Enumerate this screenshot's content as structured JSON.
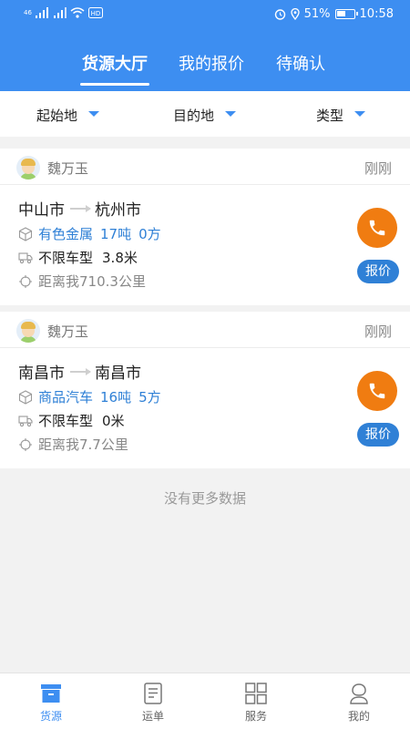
{
  "status_bar": {
    "signal_text": "46",
    "battery": "51%",
    "time": "10:58",
    "hd_label": "HD"
  },
  "tabs": [
    {
      "label": "货源大厅",
      "active": true
    },
    {
      "label": "我的报价",
      "active": false
    },
    {
      "label": "待确认",
      "active": false
    }
  ],
  "filters": {
    "origin": "起始地",
    "destination": "目的地",
    "type": "类型"
  },
  "cards": [
    {
      "user": "魏万玉",
      "time": "刚刚",
      "from": "中山市",
      "to": "杭州市",
      "cargo": "有色金属",
      "weight": "17吨",
      "volume": "0方",
      "vehicle": "不限车型",
      "length": "3.8米",
      "distance": "距离我710.3公里",
      "quote_label": "报价"
    },
    {
      "user": "魏万玉",
      "time": "刚刚",
      "from": "南昌市",
      "to": "南昌市",
      "cargo": "商品汽车",
      "weight": "16吨",
      "volume": "5方",
      "vehicle": "不限车型",
      "length": "0米",
      "distance": "距离我7.7公里",
      "quote_label": "报价"
    }
  ],
  "no_more_text": "没有更多数据",
  "bottom_nav": [
    {
      "label": "货源",
      "icon": "box-icon",
      "active": true
    },
    {
      "label": "运单",
      "icon": "document-icon",
      "active": false
    },
    {
      "label": "服务",
      "icon": "grid-icon",
      "active": false
    },
    {
      "label": "我的",
      "icon": "person-icon",
      "active": false
    }
  ],
  "colors": {
    "primary": "#3d8ef1",
    "call_orange": "#f07c11",
    "link_blue": "#2f80d6"
  }
}
